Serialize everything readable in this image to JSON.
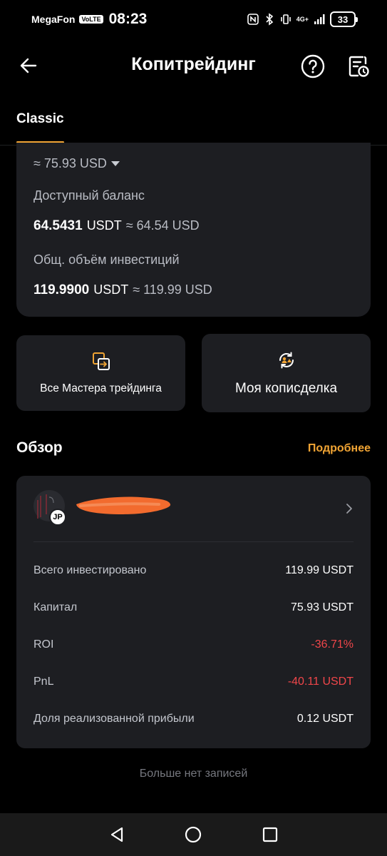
{
  "status_bar": {
    "carrier": "MegaFon",
    "volte": "VoLTE",
    "time": "08:23",
    "network": "4G+",
    "battery": "33"
  },
  "header": {
    "title": "Копитрейдинг",
    "back_icon": "arrow-left-icon",
    "help_icon": "question-circle-icon",
    "history_icon": "document-clock-icon"
  },
  "tabs": [
    {
      "label": "Classic",
      "active": true
    }
  ],
  "balance": {
    "approx_value": "≈ 75.93 USD",
    "available_label": "Доступный баланс",
    "available_amount": "64.5431",
    "available_unit": "USDT",
    "available_conv": "≈ 64.54 USD",
    "invest_label": "Общ. объём инвестиций",
    "invest_amount": "119.9900",
    "invest_unit": "USDT",
    "invest_conv": "≈ 119.99 USD"
  },
  "actions": {
    "all_masters": "Все Мастера трейдинга",
    "my_copy": "Моя кописделка"
  },
  "overview": {
    "title": "Обзор",
    "more": "Подробнее",
    "trader": {
      "badge": "JP",
      "name": ""
    },
    "stats": [
      {
        "label": "Всего инвестировано",
        "value": "119.99 USDT",
        "negative": false
      },
      {
        "label": "Капитал",
        "value": "75.93 USDT",
        "negative": false
      },
      {
        "label": "ROI",
        "value": "-36.71%",
        "negative": true
      },
      {
        "label": "PnL",
        "value": "-40.11 USDT",
        "negative": true
      },
      {
        "label": "Доля реализованной прибыли",
        "value": "0.12 USDT",
        "negative": false
      }
    ]
  },
  "footer_text": "Больше нет записей",
  "colors": {
    "accent": "#f0a434",
    "negative": "#f0464a",
    "card": "#1d1e22"
  }
}
